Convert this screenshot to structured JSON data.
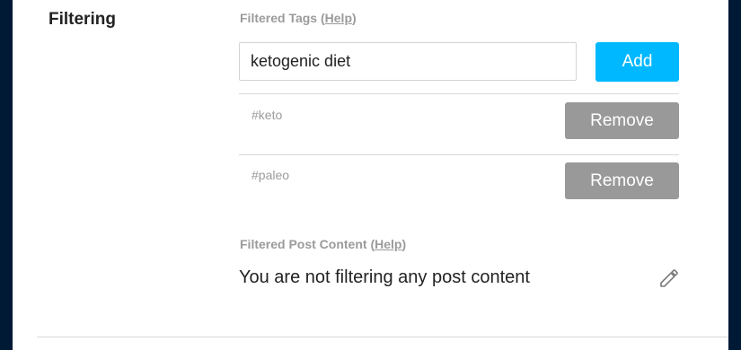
{
  "section": {
    "title": "Filtering"
  },
  "filtered_tags": {
    "label": "Filtered Tags (",
    "help": "Help",
    "label_end": ")",
    "input_value": "ketogenic diet",
    "add_label": "Add",
    "tags": [
      {
        "name": "#keto",
        "remove_label": "Remove"
      },
      {
        "name": "#paleo",
        "remove_label": "Remove"
      }
    ]
  },
  "filtered_content": {
    "label": "Filtered Post Content (",
    "help": "Help",
    "label_end": ")",
    "status": "You are not filtering any post content",
    "edit_icon": "pencil-icon"
  },
  "colors": {
    "accent": "#00b8ff",
    "remove_button": "#999999",
    "background": "#001935"
  }
}
